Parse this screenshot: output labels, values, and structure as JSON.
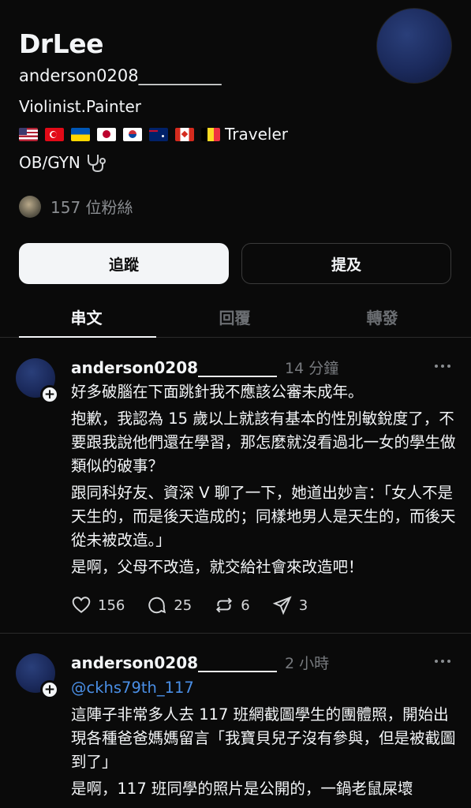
{
  "profile": {
    "display_name": "DrLee",
    "handle": "anderson0208__________",
    "bio_line1": "Violinist.Painter",
    "bio_line2_suffix": "Traveler",
    "bio_line3": "OB/GYN",
    "flags": [
      "us-flag",
      "turkey-flag",
      "ukraine-flag",
      "japan-flag",
      "korea-flag",
      "australia-flag",
      "canada-flag",
      "belgium-flag"
    ],
    "followers_text": "157 位粉絲"
  },
  "buttons": {
    "follow": "追蹤",
    "mention": "提及"
  },
  "tabs": [
    "串文",
    "回覆",
    "轉發"
  ],
  "posts": [
    {
      "author": "anderson0208__________",
      "time": "14 分鐘",
      "paragraphs": [
        "好多破腦在下面跳針我不應該公審未成年。",
        "抱歉，我認為 15 歲以上就該有基本的性別敏銳度了，不要跟我說他們還在學習，那怎麼就沒看過北一女的學生做類似的破事？",
        "跟同科好友、資深 V 聊了一下，她道出妙言：「女人不是天生的，而是後天造成的；同樣地男人是天生的，而後天從未被改造。」",
        "是啊，父母不改造，就交給社會來改造吧！"
      ],
      "likes": "156",
      "comments": "25",
      "reposts": "6",
      "shares": "3"
    },
    {
      "author": "anderson0208__________",
      "time": "2 小時",
      "mention": "@ckhs79th_117",
      "paragraphs": [
        "這陣子非常多人去 117 班網截圖學生的團體照，開始出現各種爸爸媽媽留言「我寶貝兒子沒有參與，但是被截圖到了」",
        "是啊，117 班同學的照片是公開的，一鍋老鼠屎壞"
      ]
    }
  ],
  "colors": {
    "background": "#0a0a0a",
    "text": "#f3f5f7",
    "muted": "#8a8d91",
    "mention": "#4a8fe6"
  }
}
